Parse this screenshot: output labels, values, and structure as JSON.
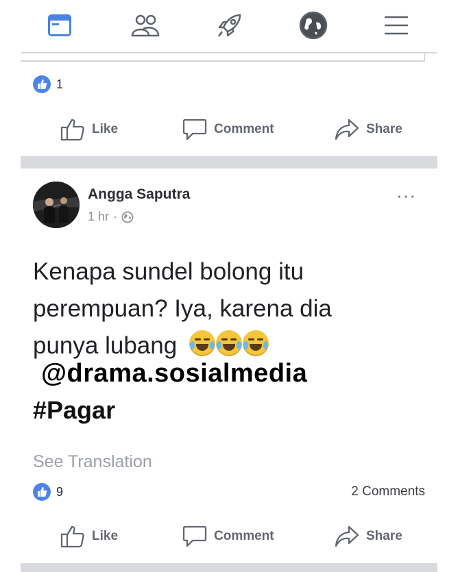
{
  "top_nav": {
    "icons": [
      "news-feed-icon",
      "friends-icon",
      "rocket-icon",
      "globe-icon",
      "menu-icon"
    ],
    "active_color": "#4a83e2",
    "inactive_color": "#5d626a"
  },
  "previous_post": {
    "like_count": "1",
    "actions": {
      "like": "Like",
      "comment": "Comment",
      "share": "Share"
    }
  },
  "post": {
    "author": "Angga Saputra",
    "time": "1 hr",
    "separator": "·",
    "audience_icon": "globe-icon",
    "more_icon": "more-dots-icon",
    "more_label": "···",
    "text_line1": "Kenapa sundel bolong itu",
    "text_line2": "perempuan? Iya, karena dia",
    "text_line3": "punya lubang",
    "emojis": [
      "tears-of-joy",
      "tears-of-joy",
      "tears-of-joy"
    ],
    "watermark": "@drama.sosialmedia",
    "hashtag": "#Pagar",
    "see_translation": "See Translation",
    "like_count": "9",
    "comments": "2 Comments",
    "actions": {
      "like": "Like",
      "comment": "Comment",
      "share": "Share"
    }
  },
  "colors": {
    "like_blue": "#4e84e6",
    "separator_gray": "#d8dadd",
    "action_gray": "#62676f"
  }
}
